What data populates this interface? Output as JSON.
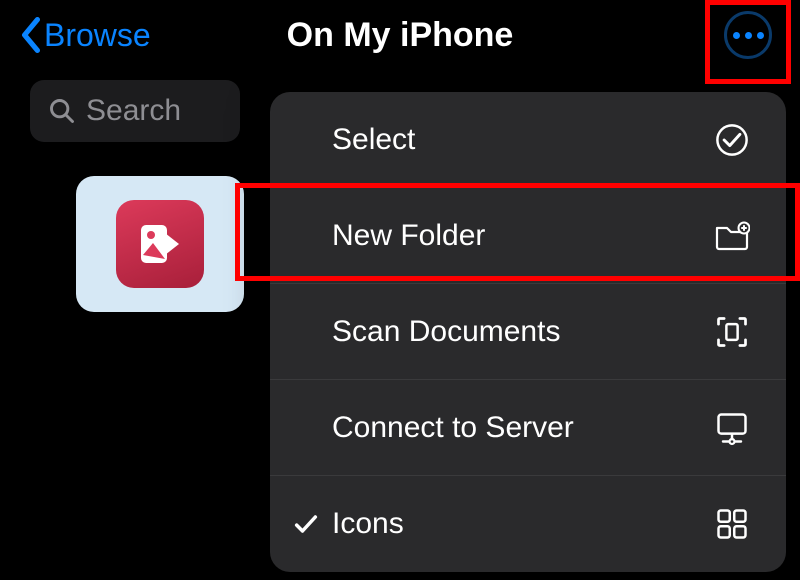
{
  "header": {
    "back_label": "Browse",
    "title": "On My iPhone"
  },
  "search": {
    "placeholder": "Search"
  },
  "popover": {
    "items": [
      {
        "label": "Select",
        "icon": "checkmark-circle-icon"
      },
      {
        "label": "New Folder",
        "icon": "folder-plus-icon"
      },
      {
        "label": "Scan Documents",
        "icon": "scan-doc-icon"
      },
      {
        "label": "Connect to Server",
        "icon": "server-icon"
      },
      {
        "label": "Icons",
        "icon": "grid-icon",
        "checked": true
      }
    ]
  }
}
